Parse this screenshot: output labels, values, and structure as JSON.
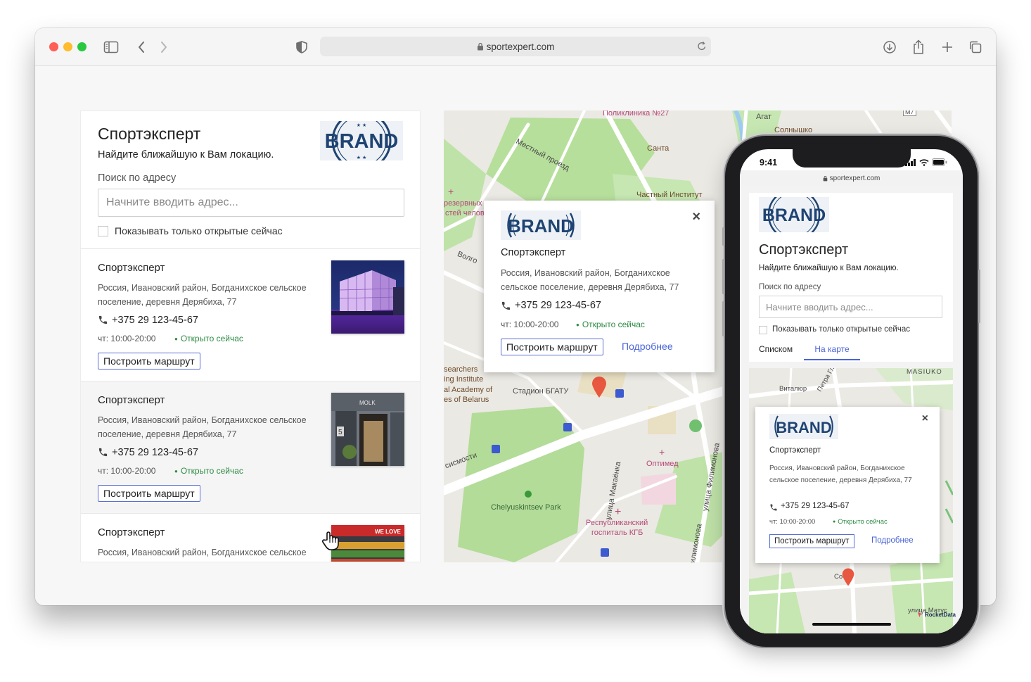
{
  "browser": {
    "url": "sportexpert.com"
  },
  "brand": {
    "logo_text": "BRAND",
    "accent_color": "#4a64d6",
    "open_color": "#2e8b45",
    "pin_color": "#e8573f"
  },
  "panel": {
    "title": "Спортэксперт",
    "subtitle": "Найдите ближайшую к Вам локацию.",
    "search_label": "Поиск по адресу",
    "search_placeholder": "Начните вводить адрес...",
    "checkbox_label": "Показывать только открытые сейчас"
  },
  "locations": [
    {
      "name": "Спортэксперт",
      "address": "Россия, Ивановский район, Богданихское сельское поселение, деревня Дерябиха, 77",
      "phone": "+375 29 123-45-67",
      "hours": "чт: 10:00-20:00",
      "status": "Открыто сейчас",
      "route_label": "Построить маршрут",
      "photo": "night-store-building"
    },
    {
      "name": "Спортэксперт",
      "address": "Россия, Ивановский район, Богданихское сельское поселение, деревня Дерябиха, 77",
      "phone": "+375 29 123-45-67",
      "hours": "чт: 10:00-20:00",
      "status": "Открыто сейчас",
      "route_label": "Построить маршрут",
      "photo": "shop-front",
      "photo_sign": "MOLK"
    },
    {
      "name": "Спортэксперт",
      "address": "Россия, Ивановский район, Богданихское сельское",
      "photo": "market-stall",
      "photo_sign": "WE LOVE"
    }
  ],
  "map": {
    "labels": [
      "Поликлиника №27",
      "Агат",
      "Солнышко",
      "Санта",
      "Местный проезд",
      "Частный Институт",
      "резервных",
      "стей челов",
      "Волго",
      "searchers",
      "ing Institute",
      "al Academy of",
      "es of Belarus",
      "Стадион БГАТУ",
      "сисмости",
      "Оптимед",
      "улица Макаёнка",
      "улица Филимонова",
      "Chelyuskintsev Park",
      "Республиканский",
      "госпиталь КГБ",
      "илимонова",
      "M7"
    ],
    "popup": {
      "name": "Спортэксперт",
      "address": "Россия, Ивановский район, Богданихское сельское поселение, деревня Дерябиха, 77",
      "phone": "+375 29 123-45-67",
      "hours": "чт: 10:00-20:00",
      "status": "Открыто сейчас",
      "route_label": "Построить маршрут",
      "more_label": "Подробнее",
      "close": "×"
    }
  },
  "phone": {
    "time": "9:41",
    "url": "sportexpert.com",
    "title": "Спортэксперт",
    "subtitle": "Найдите ближайшую к Вам локацию.",
    "search_label": "Поиск по адресу",
    "search_placeholder": "Начните вводить адрес...",
    "checkbox_label": "Показывать только открытые сейчас",
    "tabs": [
      "Списком",
      "На карте"
    ],
    "active_tab": "На карте",
    "map_labels": [
      "MASIUKO",
      "Виталюр",
      "Петра Глебки",
      "Со",
      "улица Матус"
    ],
    "popup": {
      "name": "Спортэксперт",
      "address": "Россия, Ивановский район, Богданихское сельское поселение, деревня Дерябиха, 77",
      "phone": "+375 29 123-45-67",
      "hours": "чт: 10:00-20:00",
      "status": "Открыто сейчас",
      "route_label": "Построить маршрут",
      "more_label": "Подробнее",
      "close": "×"
    },
    "footer_logo": "RocketData"
  }
}
